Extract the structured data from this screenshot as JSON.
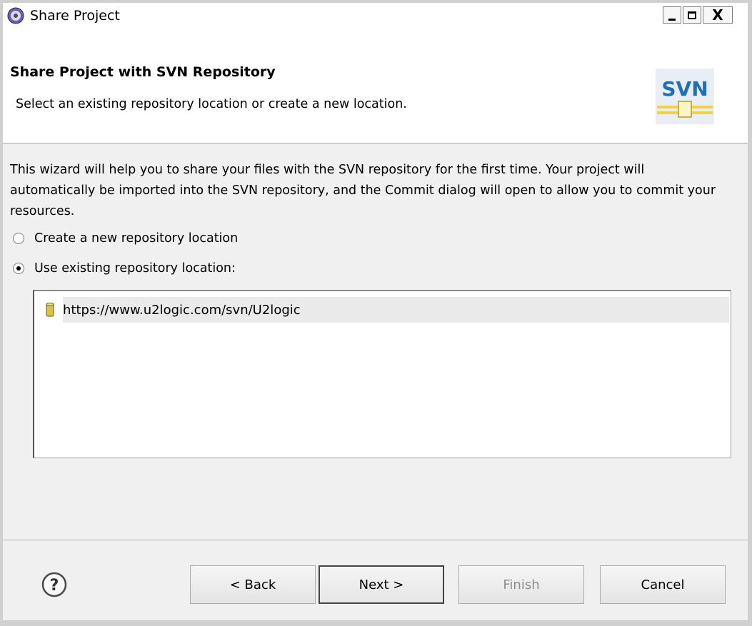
{
  "window": {
    "title": "Share Project",
    "minimize_label": "_",
    "close_label": "X"
  },
  "banner": {
    "title": "Share Project with SVN Repository",
    "description": "Select an existing repository location or create a new location.",
    "logo_text": "SVN"
  },
  "body": {
    "intro": "This wizard will help you to share your files with the SVN repository for the first time. Your project will automatically be imported into the SVN repository, and the Commit dialog will open to allow you to commit your resources.",
    "options": [
      {
        "label": "Create a new repository location",
        "selected": false
      },
      {
        "label": "Use existing repository location:",
        "selected": true
      }
    ],
    "repositories": [
      {
        "url": "https://www.u2logic.com/svn/U2logic",
        "icon": "repository-icon",
        "selected": true
      }
    ]
  },
  "footer": {
    "help_symbol": "?",
    "back_label": "< Back",
    "next_label": "Next >",
    "finish_label": "Finish",
    "finish_enabled": false,
    "cancel_label": "Cancel"
  },
  "colors": {
    "window_bg": "#f0f0f0",
    "banner_bg": "#ffffff",
    "svn_blue": "#1e6fb3",
    "svn_yellow": "#f5d23a",
    "repo_icon": "#d9c14b",
    "disabled_text": "#8c8c8c"
  }
}
